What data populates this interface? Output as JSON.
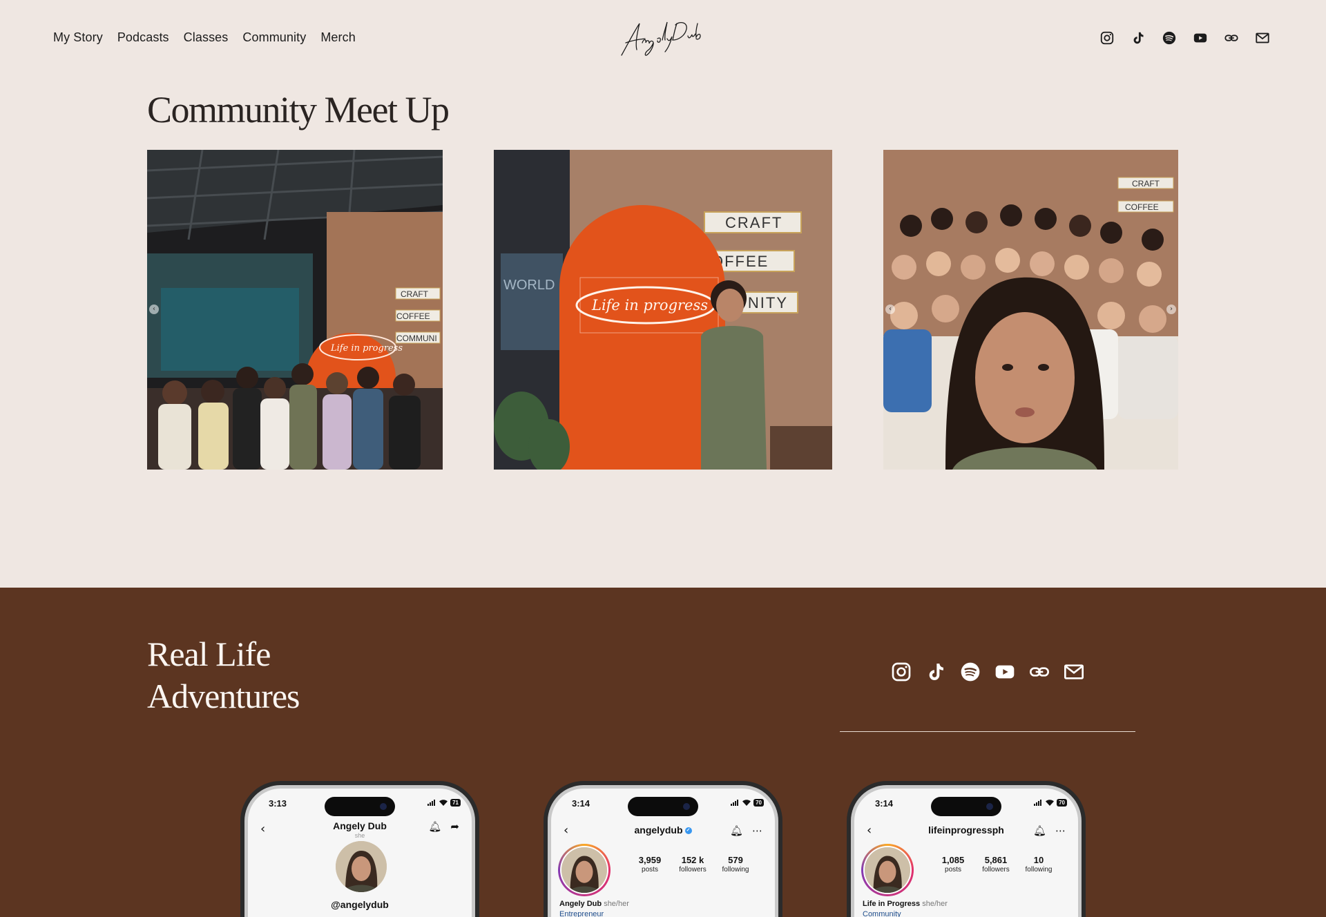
{
  "header": {
    "nav": [
      "My Story",
      "Podcasts",
      "Classes",
      "Community",
      "Merch"
    ],
    "logo_text": "AngelyDub",
    "social_icons": [
      "instagram-icon",
      "tiktok-icon",
      "spotify-icon",
      "youtube-icon",
      "link-icon",
      "mail-icon"
    ]
  },
  "community": {
    "title": "Community Meet Up",
    "photos": [
      {
        "signs": [
          "CRAFT",
          "COFFEE",
          "COMMUNI"
        ],
        "neon": "Life in progress"
      },
      {
        "signs": [
          "CRAFT",
          "OFFEE",
          "UNITY"
        ],
        "neon": "Life in progress",
        "wall_text": "WORLD"
      },
      {
        "signs": [
          "CRAFT",
          "COFFEE"
        ]
      }
    ]
  },
  "adventures": {
    "title_line1": "Real Life",
    "title_line2": "Adventures",
    "social_icons": [
      "instagram-icon",
      "tiktok-icon",
      "spotify-icon",
      "youtube-icon",
      "link-icon",
      "mail-icon"
    ]
  },
  "phones": [
    {
      "time": "3:13",
      "battery": "71",
      "name": "Angely Dub",
      "pronoun": "she",
      "handle": "@angelydub"
    },
    {
      "time": "3:14",
      "battery": "70",
      "username": "angelydub",
      "posts": "3,959",
      "followers": "152 k",
      "following": "579",
      "posts_label": "posts",
      "followers_label": "followers",
      "following_label": "following",
      "bio_name": "Angely Dub",
      "bio_pronoun": "she/her",
      "bio_category": "Entrepreneur"
    },
    {
      "time": "3:14",
      "battery": "70",
      "username": "lifeinprogressph",
      "posts": "1,085",
      "followers": "5,861",
      "following": "10",
      "posts_label": "posts",
      "followers_label": "followers",
      "following_label": "following",
      "bio_name": "Life in Progress",
      "bio_pronoun": "she/her",
      "bio_category": "Community"
    }
  ],
  "colors": {
    "page_bg": "#efe7e2",
    "brown_bg": "#5c3521",
    "neon_orange": "#e2531b"
  }
}
